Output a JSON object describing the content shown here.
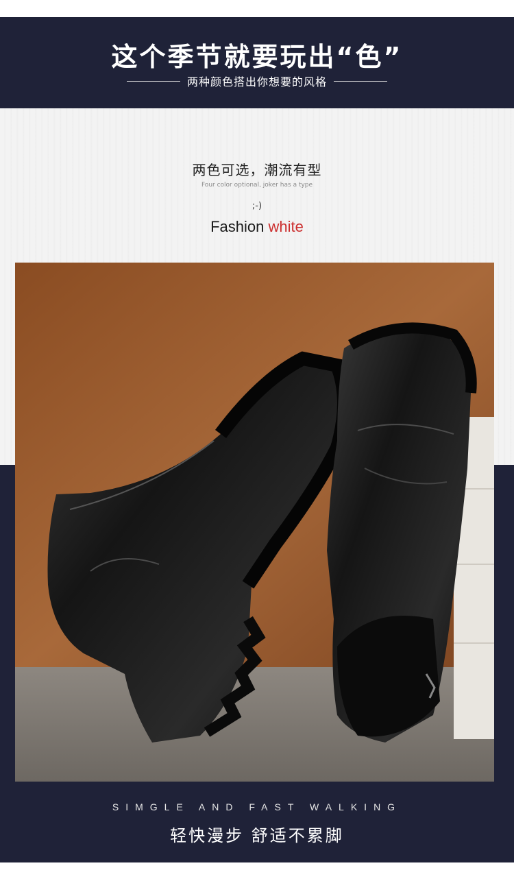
{
  "banner": {
    "title": "这个季节就要玩出“色”",
    "subtitle": "两种颜色搭出你想要的风格"
  },
  "options": {
    "title": "两色可选，潮流有型",
    "subtitle": "Four color optional, joker has a type",
    "smiley": ";-)",
    "label_prefix": "Fashion",
    "label_accent": "white"
  },
  "photo": {
    "subject": "black leather ankle boots"
  },
  "tagline": {
    "english": "SIMGLE AND FAST WALKING",
    "chinese": "轻快漫步 舒适不累脚"
  },
  "colors": {
    "navy": "#1f2238",
    "accent_red": "#cc2f2f",
    "backdrop_brown": "#9a5a2c"
  }
}
